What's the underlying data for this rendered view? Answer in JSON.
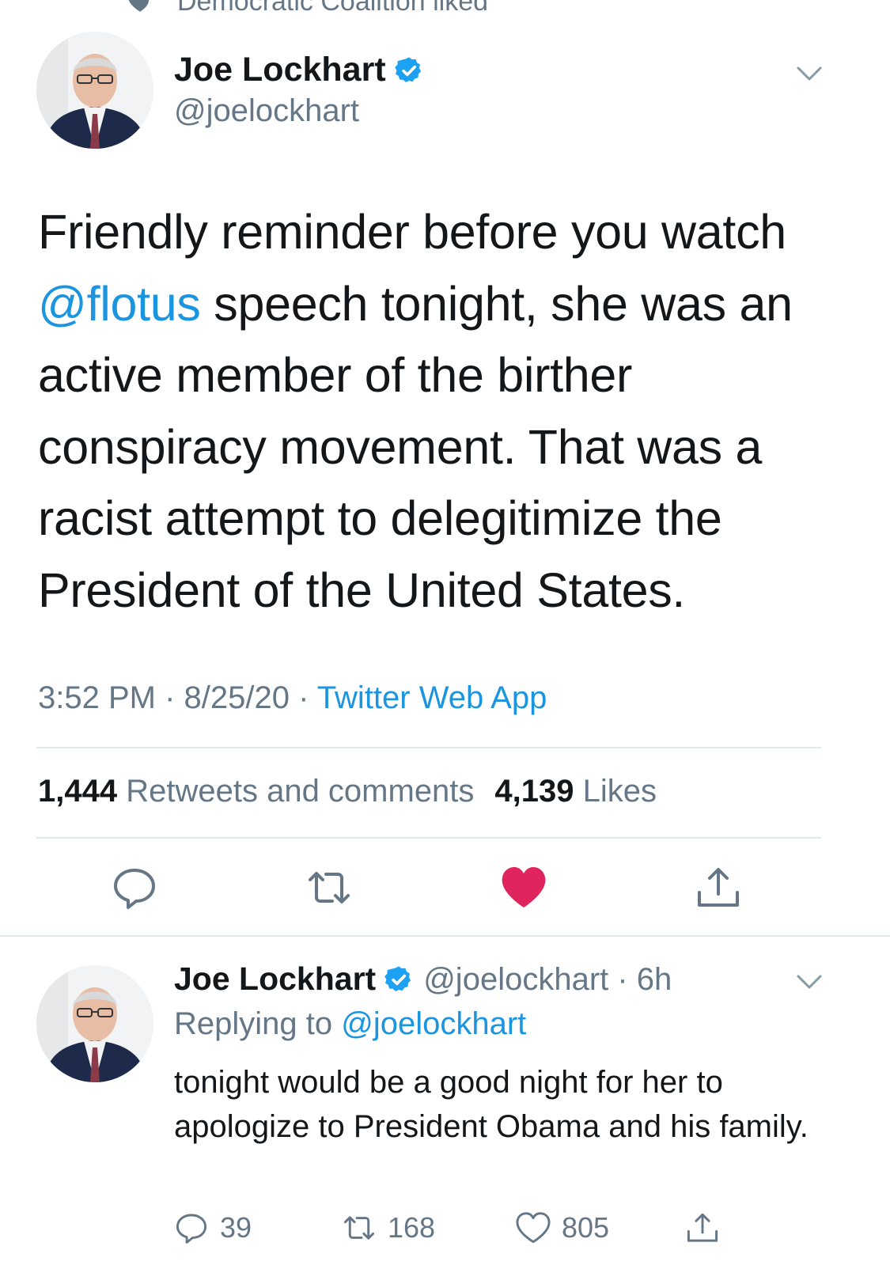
{
  "social_context": {
    "text": "Democratic Coalition liked",
    "icon": "heart-icon"
  },
  "tweet": {
    "author": {
      "name": "Joe Lockhart",
      "handle": "@joelockhart",
      "verified": true
    },
    "text_parts": {
      "line1": "Friendly reminder before you watch",
      "mention": "@flotus",
      "rest": " speech tonight, she was an active member of the birther conspiracy movement. That was a racist attempt to delegitimize the President of the United States."
    },
    "time": "3:52 PM",
    "dot1": " · ",
    "date": "8/25/20",
    "dot2": " · ",
    "source": "Twitter Web App",
    "stats": {
      "retweets_count": "1,444",
      "retweets_label": " Retweets and comments",
      "likes_count": "4,139",
      "likes_label": " Likes"
    },
    "actions": [
      "reply-icon",
      "retweet-icon",
      "like-icon",
      "share-icon"
    ],
    "liked": true
  },
  "reply": {
    "author": {
      "name": "Joe Lockhart",
      "handle": "@joelockhart",
      "verified": true
    },
    "handle_time": "@joelockhart · 6h",
    "replying_prefix": "Replying to ",
    "replying_to": "@joelockhart",
    "text": "tonight would be a good night for her to apologize to President Obama and his family.",
    "counts": {
      "replies": "39",
      "retweets": "168",
      "likes": "805"
    }
  },
  "colors": {
    "link": "#1b95e0",
    "muted": "#657786",
    "like": "#e0245e",
    "verified": "#1da1f2",
    "divider": "#e1e8ed"
  }
}
